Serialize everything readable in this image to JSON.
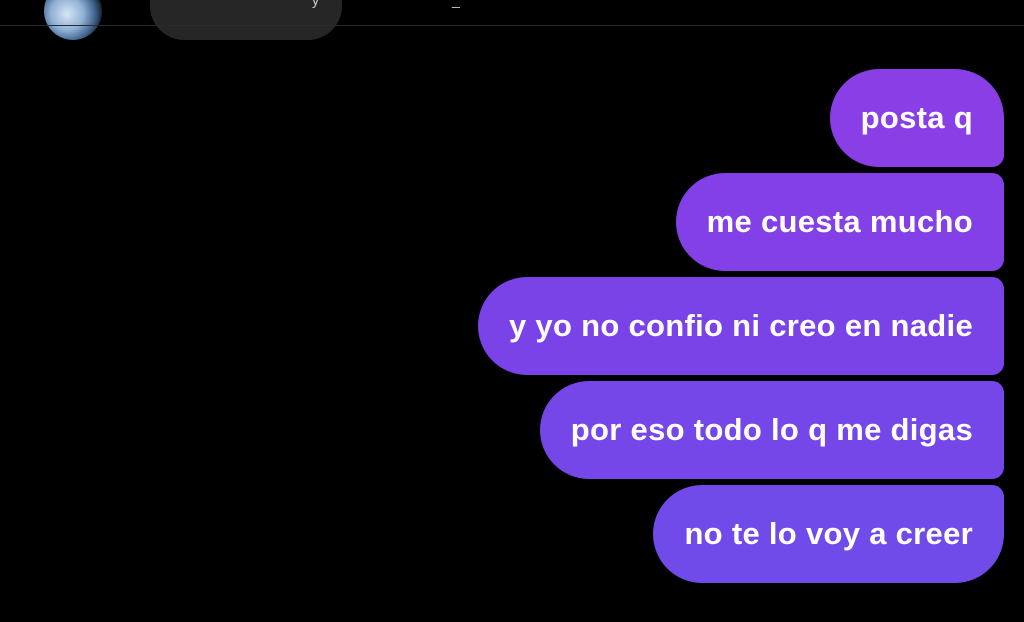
{
  "header": {
    "partial_glyphs": [
      "y",
      "_"
    ]
  },
  "colors": {
    "background": "#000000",
    "bubble_gradient_top": "#8a3ee6",
    "bubble_gradient_bottom": "#704be9",
    "message_text": "#ffffff"
  },
  "messages": [
    {
      "text": "posta q",
      "sender": "me"
    },
    {
      "text": "me cuesta mucho",
      "sender": "me"
    },
    {
      "text": "y yo no confio ni creo en nadie",
      "sender": "me"
    },
    {
      "text": "por eso todo lo q me digas",
      "sender": "me"
    },
    {
      "text": "no te lo voy a creer",
      "sender": "me"
    }
  ]
}
